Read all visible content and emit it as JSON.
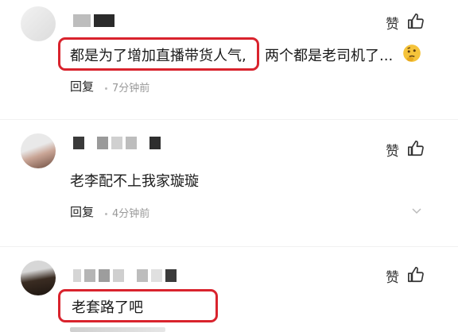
{
  "comments": [
    {
      "text_highlight": "都是为了增加直播带货人气,",
      "text_rest": "两个都是老司机了...",
      "reply_label": "回复",
      "time": "7分钟前",
      "like_label": "赞"
    },
    {
      "text": "老李配不上我家璇璇",
      "reply_label": "回复",
      "time": "4分钟前",
      "like_label": "赞"
    },
    {
      "text": "老套路了吧",
      "like_label": "赞"
    }
  ],
  "colors": {
    "highlight": "#d9232d",
    "muted": "#999999"
  },
  "icons": [
    "thumbs-up-icon",
    "thinking-emoji-icon",
    "more-icon"
  ]
}
